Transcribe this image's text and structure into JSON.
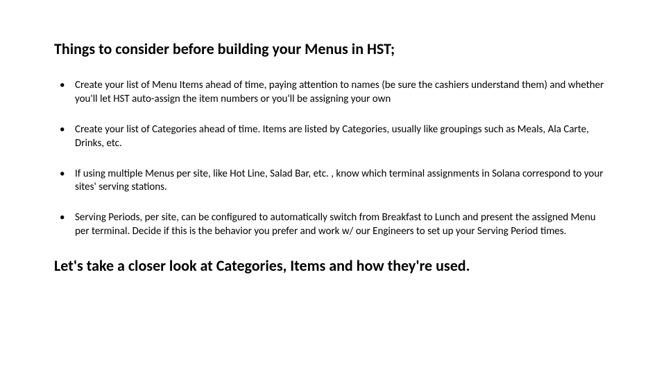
{
  "title": "Things to consider before building your Menus in HST;",
  "bullets": [
    "Create your list of Menu Items ahead of time, paying attention to names (be sure the cashiers understand them) and whether you'll let HST auto-assign the item numbers or you'll be assigning your own",
    "Create your list of Categories ahead of time. Items are listed by Categories, usually like groupings such as Meals, Ala Carte, Drinks, etc.",
    "If using multiple Menus per site, like Hot Line, Salad Bar, etc. , know which terminal assignments in Solana correspond to your sites' serving stations.",
    "Serving Periods, per site, can be configured to automatically switch from Breakfast to Lunch and present the assigned Menu per terminal. Decide if this is the behavior you prefer and work w/ our Engineers to set up your Serving Period times."
  ],
  "closing": "Let's take a closer look at Categories, Items and how they're used."
}
